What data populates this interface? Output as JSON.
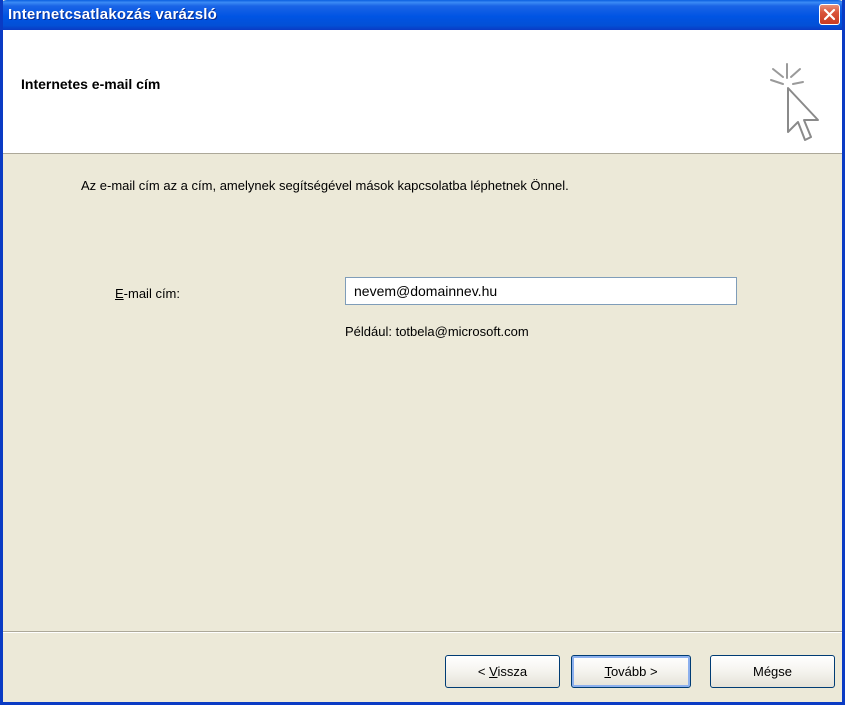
{
  "window": {
    "title": "Internetcsatlakozás varázsló"
  },
  "header": {
    "title": "Internetes e-mail cím"
  },
  "main": {
    "intro": "Az e-mail cím az a cím, amelynek segítségével mások kapcsolatba léphetnek Önnel.",
    "email_label_mnemonic": "E",
    "email_label_rest": "-mail cím:",
    "email_value": "nevem@domainnev.hu",
    "example": "Például: totbela@microsoft.com"
  },
  "buttons": {
    "back_prefix": "< ",
    "back_mnemonic": "V",
    "back_rest": "issza",
    "next_mnemonic": "T",
    "next_rest": "ovább >",
    "cancel": "Mégse"
  },
  "colors": {
    "titlebar": "#0054e3",
    "dialog_bg": "#ece9d8",
    "close_button": "#d9533a"
  },
  "icons": {
    "close": "close-icon",
    "wizard": "wizard-cursor-icon"
  }
}
